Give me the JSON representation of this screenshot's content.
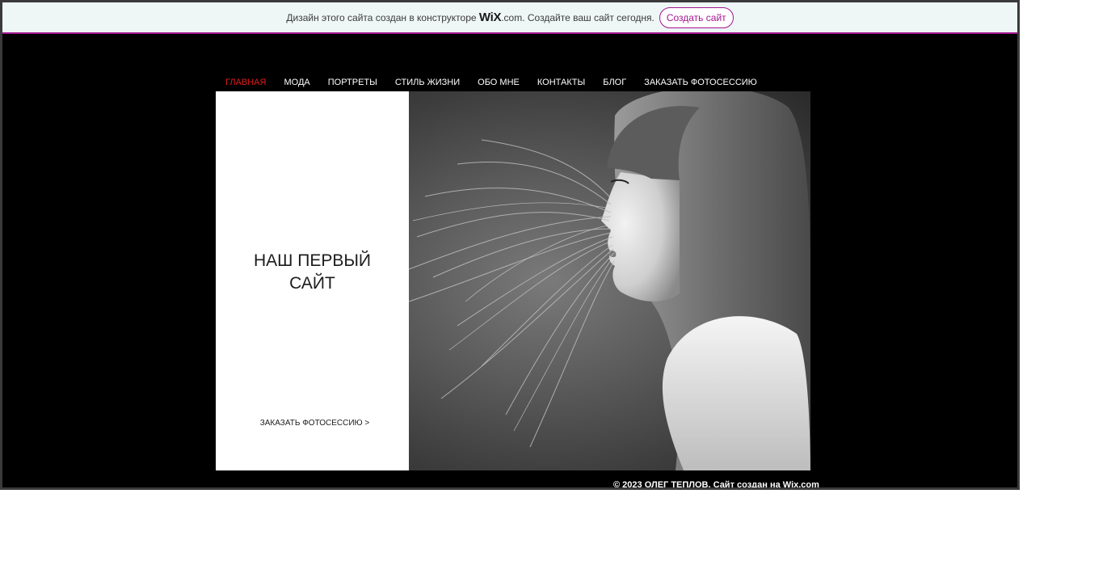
{
  "banner": {
    "text_before": "Дизайн этого сайта создан в конструкторе",
    "logo": "WiX",
    "logo_suffix": ".com.",
    "text_after": "Создайте ваш сайт сегодня.",
    "button_label": "Создать сайт",
    "accent_color": "#a2168f"
  },
  "nav": {
    "items": [
      {
        "label": "ГЛАВНАЯ",
        "active": true
      },
      {
        "label": "МОДА"
      },
      {
        "label": "ПОРТРЕТЫ"
      },
      {
        "label": "СТИЛЬ ЖИЗНИ"
      },
      {
        "label": "ОБО МНЕ"
      },
      {
        "label": "КОНТАКТЫ"
      },
      {
        "label": "БЛОГ"
      },
      {
        "label": "ЗАКАЗАТЬ ФОТОСЕССИЮ"
      }
    ],
    "active_color": "#e21b1b"
  },
  "hero": {
    "title_line1": "НАШ ПЕРВЫЙ",
    "title_line2": "САЙТ",
    "cta": "ЗАКАЗАТЬ ФОТОСЕССИЮ >"
  },
  "footer": {
    "text": "© 2023 ОЛЕГ ТЕПЛОВ. Сайт создан на Wix.com"
  }
}
